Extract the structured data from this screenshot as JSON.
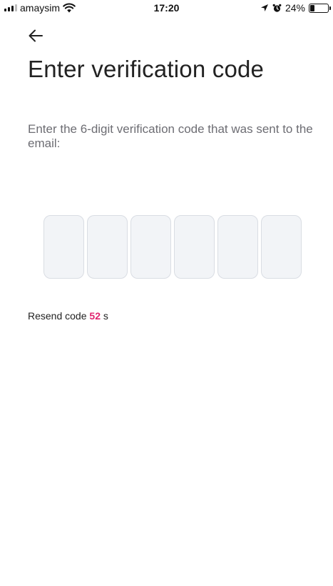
{
  "status_bar": {
    "carrier": "amaysim",
    "time": "17:20",
    "battery": "24%",
    "battery_level": 0.24,
    "icons": [
      "signal-icon",
      "wifi-icon",
      "location-arrow-icon",
      "alarm-icon",
      "battery-icon"
    ]
  },
  "header": {
    "back_icon": "arrow-left-icon",
    "title": "Enter verification code"
  },
  "instruction": "Enter the 6-digit verification code that was sent to the email:",
  "code_inputs": [
    "",
    "",
    "",
    "",
    "",
    ""
  ],
  "resend": {
    "label": "Resend code",
    "seconds": "52",
    "unit": "s"
  },
  "colors": {
    "accent": "#e0246f",
    "title_text": "#222222",
    "muted_text": "#6d6d73",
    "box_fill": "#f2f4f7",
    "box_border": "#d9dde3"
  }
}
